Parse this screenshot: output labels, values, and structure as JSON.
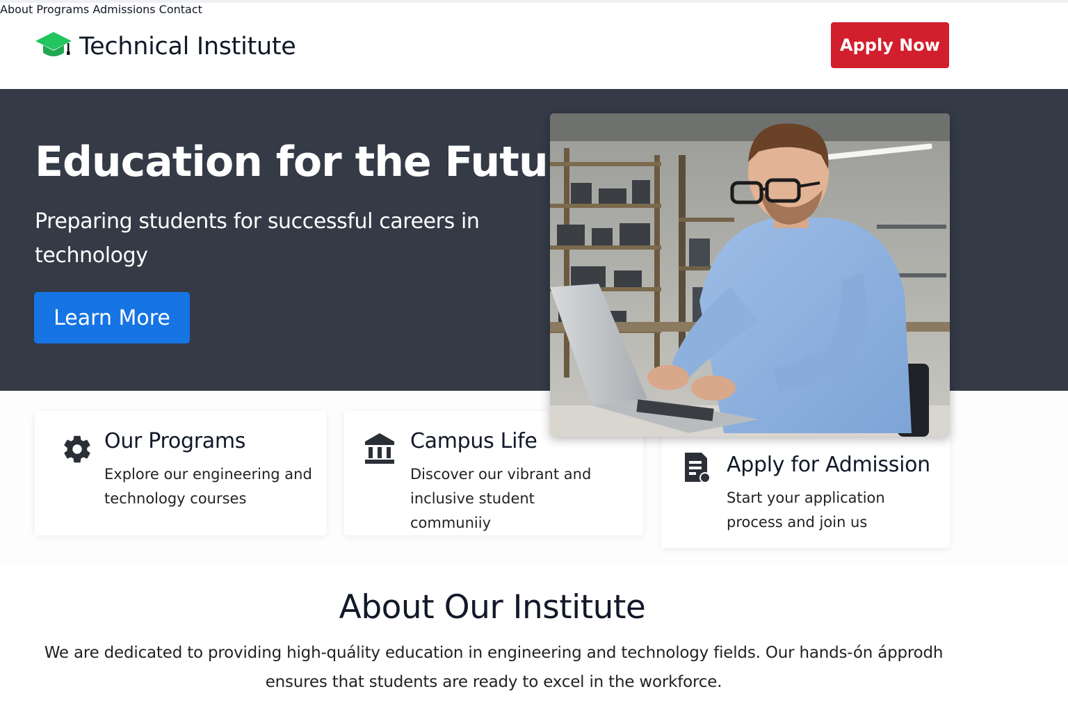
{
  "header": {
    "brand": "Technical Institute",
    "nav": [
      "About",
      "Programs",
      "Admissions",
      "Contact"
    ],
    "apply_label": "Apply Now"
  },
  "hero": {
    "title": "Education for the Future",
    "subtitle": "Preparing students for successful careers in technology",
    "cta_label": "Learn More"
  },
  "cards": [
    {
      "icon": "gear-icon",
      "title": "Our Programs",
      "text": "Explore our engineering and technology courses"
    },
    {
      "icon": "institution-icon",
      "title": "Campus Life",
      "text": "Discover our vibrant and inclusive student communiiy"
    },
    {
      "icon": "document-icon",
      "title": "Apply for Admission",
      "text": "Start your application process and join us"
    }
  ],
  "about": {
    "title": "About Our Institute",
    "text": "We are dedicated to providing high-quálity education in engineering and technology fields. Our hands-ón ápprodh ensures that students are ready to excel in the workforce."
  },
  "colors": {
    "brand_green": "#22c55e",
    "apply_red": "#d21f2e",
    "hero_bg": "#343b47",
    "cta_blue": "#1674e4"
  }
}
